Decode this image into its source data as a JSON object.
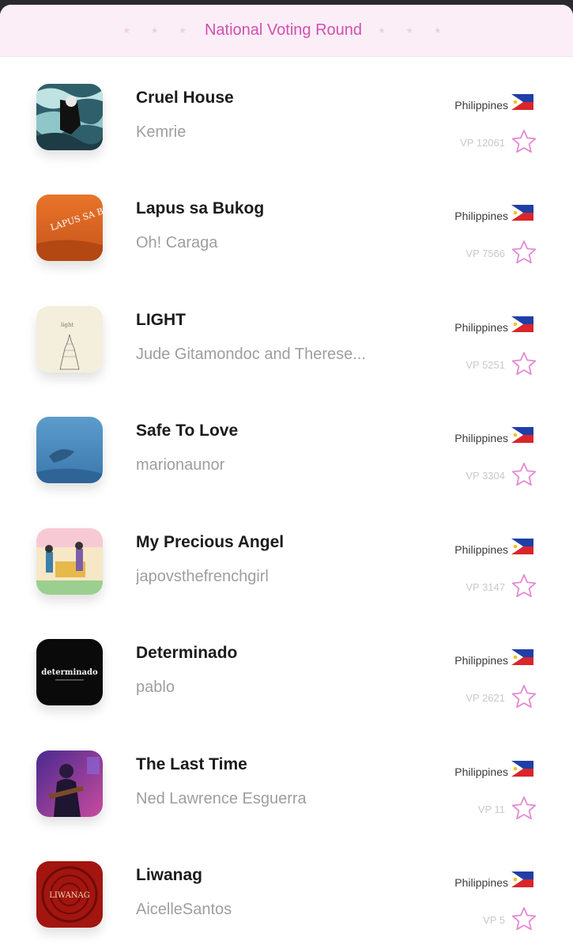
{
  "header": {
    "title": "National Voting Round",
    "deco_left": "★ ★ ★",
    "deco_right": "★ ★ ★"
  },
  "colors": {
    "accent": "#d14fb0",
    "header_bg": "#fbeef7",
    "star_outline": "#e48ad3"
  },
  "entries": [
    {
      "title": "Cruel House",
      "artist": "Kemrie",
      "country": "Philippines",
      "vp": "VP 12061",
      "flag_icon": "philippines-flag-icon"
    },
    {
      "title": "Lapus sa Bukog",
      "artist": "Oh! Caraga",
      "country": "Philippines",
      "vp": "VP 7566",
      "flag_icon": "philippines-flag-icon",
      "cover_text": "LAPUS SA BUKOG"
    },
    {
      "title": "LIGHT",
      "artist": "Jude Gitamondoc and Therese...",
      "country": "Philippines",
      "vp": "VP 5251",
      "flag_icon": "philippines-flag-icon",
      "cover_text": "light"
    },
    {
      "title": "Safe To Love",
      "artist": "marionaunor",
      "country": "Philippines",
      "vp": "VP 3304",
      "flag_icon": "philippines-flag-icon"
    },
    {
      "title": "My Precious Angel",
      "artist": "japovsthefrenchgirl",
      "country": "Philippines",
      "vp": "VP 3147",
      "flag_icon": "philippines-flag-icon"
    },
    {
      "title": "Determinado",
      "artist": "pablo",
      "country": "Philippines",
      "vp": "VP 2621",
      "flag_icon": "philippines-flag-icon",
      "cover_text": "determinado"
    },
    {
      "title": "The Last Time",
      "artist": "Ned Lawrence Esguerra",
      "country": "Philippines",
      "vp": "VP 11",
      "flag_icon": "philippines-flag-icon"
    },
    {
      "title": "Liwanag",
      "artist": "AicelleSantos",
      "country": "Philippines",
      "vp": "VP 5",
      "flag_icon": "philippines-flag-icon",
      "cover_text": "LIWANAG"
    }
  ]
}
